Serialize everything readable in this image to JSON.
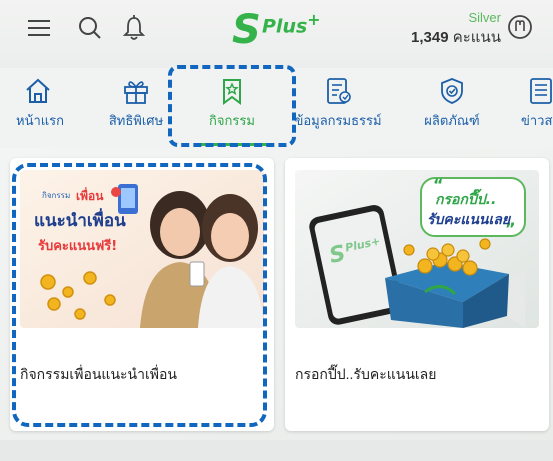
{
  "header": {
    "menu_icon": "hamburger-menu-icon",
    "search_icon": "search-icon",
    "bell_icon": "notification-bell-icon",
    "logo_letter": "S",
    "logo_text": "Plus",
    "logo_sup": "+",
    "tier": "Silver",
    "points_value": "1,349",
    "points_unit": "คะแนน",
    "user_icon": "user-profile-icon"
  },
  "nav": {
    "items": [
      {
        "label": "หน้าแรก",
        "icon": "home-icon"
      },
      {
        "label": "สิทธิพิเศษ",
        "icon": "gift-icon"
      },
      {
        "label": "กิจกรรม",
        "icon": "bookmark-star-icon"
      },
      {
        "label": "ข้อมูลกรมธรรม์",
        "icon": "policy-document-icon"
      },
      {
        "label": "ผลิตภัณฑ์",
        "icon": "shield-check-icon"
      },
      {
        "label": "ข่าวส",
        "icon": "news-icon"
      }
    ],
    "active_index": 2
  },
  "cards": [
    {
      "title": "กิจกรรมเพื่อนแนะนำเพื่อน",
      "banner_tag": "กิจกรรม",
      "banner_word": "เพื่อน",
      "banner_line1": "แนะนำเพื่อน",
      "banner_line2": "รับคะแนนฟรี!"
    },
    {
      "title": "กรอกปี๊ป..รับคะแนนเลย",
      "banner_line1": "กรอกปี๊ป..",
      "banner_line2": "รับคะแนนเลย",
      "phone_logo": "S",
      "phone_logo_plus": "Plus+"
    }
  ],
  "colors": {
    "brand_green": "#35b34a",
    "nav_blue": "#1c5fa8",
    "annotation_blue": "#1166c0"
  }
}
